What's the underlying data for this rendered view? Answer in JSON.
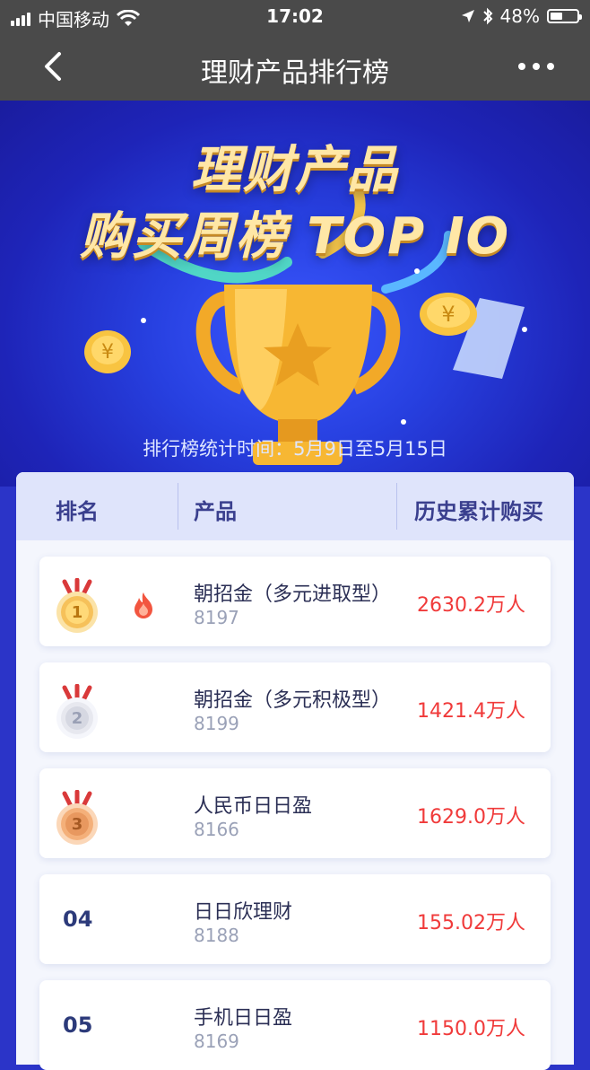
{
  "status": {
    "carrier": "中国移动",
    "time": "17:02",
    "battery": "48%",
    "battery_level": 0.48
  },
  "nav": {
    "title": "理财产品排行榜"
  },
  "hero": {
    "line1": "理财产品",
    "line2": "购买周榜 TOP IO",
    "stat_text": "排行榜统计时间：5月9日至5月15日"
  },
  "table": {
    "headers": [
      "排名",
      "产品",
      "历史累计购买"
    ],
    "rows": [
      {
        "rank": "1",
        "medal": "gold",
        "hot": true,
        "name": "朝招金（多元进取型）",
        "code": "8197",
        "count": "2630.2万人"
      },
      {
        "rank": "2",
        "medal": "silver",
        "hot": false,
        "name": "朝招金（多元积极型）",
        "code": "8199",
        "count": "1421.4万人"
      },
      {
        "rank": "3",
        "medal": "bronze",
        "hot": false,
        "name": "人民币日日盈",
        "code": "8166",
        "count": "1629.0万人"
      },
      {
        "rank": "04",
        "medal": "",
        "hot": false,
        "name": "日日欣理财",
        "code": "8188",
        "count": "155.02万人"
      },
      {
        "rank": "05",
        "medal": "",
        "hot": false,
        "name": "手机日日盈",
        "code": "8169",
        "count": "1150.0万人"
      }
    ]
  },
  "colors": {
    "accent_red": "#f03a3a",
    "header_text": "#3a3f8e",
    "hero_gold": "#ffe7a6"
  }
}
